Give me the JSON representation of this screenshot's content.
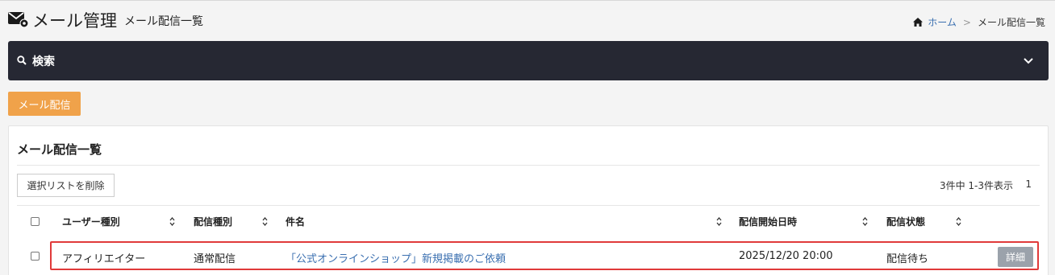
{
  "header": {
    "title": "メール管理",
    "subtitle": "メール配信一覧"
  },
  "breadcrumb": {
    "home": "ホーム",
    "separator": ">",
    "current": "メール配信一覧"
  },
  "search": {
    "label": "検索"
  },
  "toolbar": {
    "mail_button": "メール配信"
  },
  "list": {
    "title": "メール配信一覧",
    "delete_button": "選択リストを削除",
    "pagination_info": "3件中 1-3件表示",
    "current_page": "1",
    "columns": [
      "ユーザー種別",
      "配信種別",
      "件名",
      "配信開始日時",
      "配信状態"
    ],
    "rows": [
      {
        "user_type": "アフィリエイター",
        "delivery_type": "通常配信",
        "subject": "「公式オンラインショップ」新規掲載のご依頼",
        "start_datetime": "2025/12/20 20:00",
        "status": "配信待ち",
        "detail_label": "詳細"
      }
    ]
  },
  "colors": {
    "search_bar": "#262833",
    "mail_button": "#f0a24a",
    "link": "#3a6fb0",
    "highlight_border": "#e03a3a",
    "detail_button": "#9ba2ab"
  }
}
